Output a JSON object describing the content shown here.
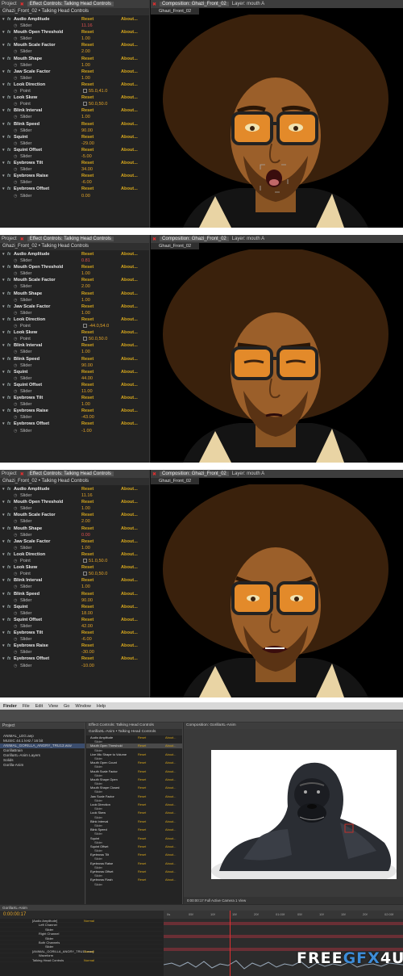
{
  "common": {
    "project_tab": "Project",
    "effect_tab": "Effect Controls: Talking Head Controls",
    "panel_title": "Ghazi_Front_02 • Talking Head Controls",
    "reset": "Reset",
    "about": "About...",
    "slider": "Slider",
    "point": "Point",
    "comp_tab": "Composition: Ghazi_Front_02",
    "layer_tab": "Layer: mouth A",
    "comp_subtab": "Ghazi_Front_02",
    "fx": "fx"
  },
  "property_names": [
    "Audio Amplitude",
    "Mouth Open Threshold",
    "Mouth Scale Factor",
    "Mouth Shape",
    "Jaw Scale Factor",
    "Look Direction",
    "Look Skew",
    "Blink Interval",
    "Blink Speed",
    "Squint",
    "Squint Offset",
    "Eyebrows Tilt",
    "Eyebrows Raise",
    "Eyebrows Offset"
  ],
  "panels": [
    {
      "values": [
        "11.16",
        "1.00",
        "2.00",
        "1.00",
        "1.00",
        "55.0,41.0",
        "50.0,50.0",
        "1.00",
        "90.00",
        "-29.00",
        "-5.00",
        "34.00",
        "-6.00",
        "0.00"
      ]
    },
    {
      "values": [
        "0.81",
        "1.00",
        "2.00",
        "1.00",
        "1.00",
        "-44.0,54.0",
        "50.0,50.0",
        "1.00",
        "90.00",
        "44.00",
        "11.00",
        "1.00",
        "-43.00",
        "-1.00"
      ]
    },
    {
      "values": [
        "11.16",
        "1.00",
        "2.00",
        "0.00",
        "1.00",
        "51.0,50.0",
        "50.0,50.0",
        "1.00",
        "90.00",
        "18.00",
        "42.00",
        "-6.00",
        "-30.00",
        "-10.00"
      ]
    }
  ],
  "ae": {
    "menu": [
      "Finder",
      "File",
      "Edit",
      "View",
      "Go",
      "Window",
      "Help"
    ],
    "project_label": "Project",
    "project_files": [
      "ANIMAL_LEG.aep",
      "MUSIC 44.1 kHz / 16 bit",
      "ANIMAL_GORILLA_ANGRY_TRU13.wav",
      "GorillaBrain",
      "GorillaXL-Anim Layers",
      "Solids",
      "Gorilla-Anim"
    ],
    "effect_title": "Effect Controls: Talking Head Controls",
    "effect_sub": "GorillaXL-Anim • Talking Head Controls",
    "comp_title": "Composition: GorillaXL-Anim",
    "comp_footer": "0:00:00:17   Full   Active Camera   1 View",
    "props": [
      "Audio Amplitude",
      "Mouth Open Threshold",
      "Live Mic Shape to Volume",
      "Mouth Open Count",
      "Mouth Scale Factor",
      "Mouth Shape Open",
      "Mouth Shape Closed",
      "Jaw Scale Factor",
      "Look Direction",
      "Look Skew",
      "Blink Interval",
      "Blink Speed",
      "Squint",
      "Squint Offset",
      "Eyebrows Tilt",
      "Eyebrows Raise",
      "Eyebrows Offset",
      "Eyebrows Flash"
    ],
    "timecode": "0:00:00:17",
    "timeline_tab": "GorillaXL-Anim",
    "layers": [
      "[Audio Amplitude]",
      "Left Channel",
      "Slider",
      "Right Channel",
      "Slider",
      "Both Channels",
      "Slider",
      "[ANIMAL_GORILLA_ANGRY_TRU13.wav]",
      "Waveform",
      "Talking Head Controls"
    ],
    "layer_mode": "Normal",
    "ruler": [
      "0s",
      "05f",
      "10f",
      "15f",
      "20f",
      "01:00f",
      "05f",
      "10f",
      "15f",
      "20f",
      "02:00f"
    ]
  },
  "watermark": {
    "a": "FREE",
    "b": "GFX",
    "c": "4U"
  }
}
